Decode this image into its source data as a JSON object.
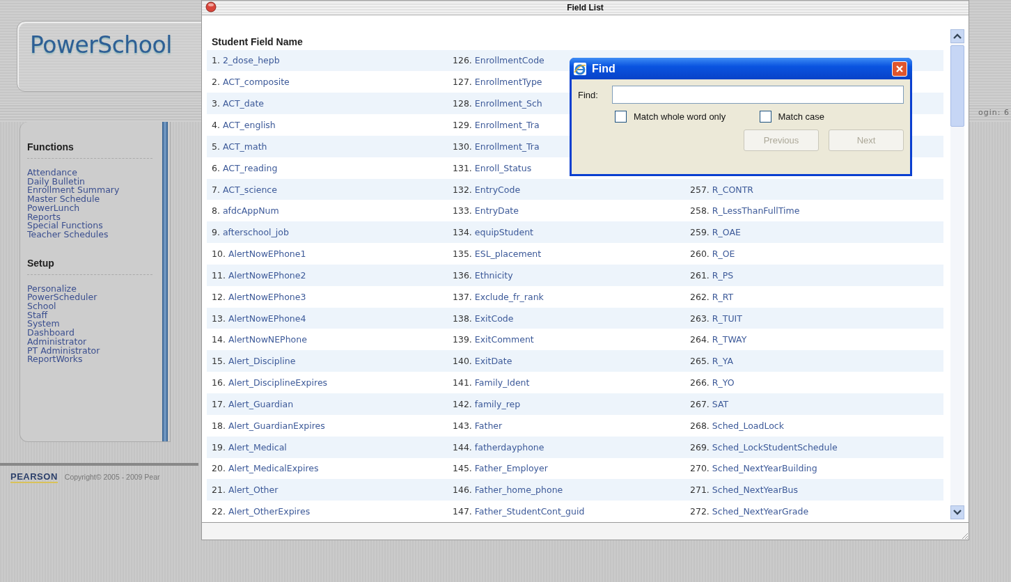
{
  "header": {
    "logo": "PowerSchool",
    "login": "ogin: 6"
  },
  "sidebar": {
    "sections": [
      {
        "title": "Functions",
        "items": [
          "Attendance",
          "Daily Bulletin",
          "Enrollment Summary",
          "Master Schedule",
          "PowerLunch",
          "Reports",
          "Special Functions",
          "Teacher Schedules"
        ]
      },
      {
        "title": "Setup",
        "items": [
          "Personalize",
          "PowerScheduler",
          "School",
          "Staff",
          "System",
          "Dashboard",
          "Administrator",
          "PT Administrator",
          "ReportWorks"
        ]
      }
    ]
  },
  "footer": {
    "brand": "PEARSON",
    "copyright": "Copyright© 2005 - 2009 Pear"
  },
  "field_list": {
    "title": "Field List",
    "heading": "Student Field Name",
    "rows": [
      {
        "column_1": {
          "number": "1.",
          "name": "2_dose_hepb"
        },
        "column_2": {
          "number": "126.",
          "name": "EnrollmentCode"
        }
      },
      {
        "column_1": {
          "number": "2.",
          "name": "ACT_composite"
        },
        "column_2": {
          "number": "127.",
          "name": "EnrollmentType"
        }
      },
      {
        "column_1": {
          "number": "3.",
          "name": "ACT_date"
        },
        "column_2": {
          "number": "128.",
          "name": "Enrollment_Sch"
        }
      },
      {
        "column_1": {
          "number": "4.",
          "name": "ACT_english"
        },
        "column_2": {
          "number": "129.",
          "name": "Enrollment_Tra"
        }
      },
      {
        "column_1": {
          "number": "5.",
          "name": "ACT_math"
        },
        "column_2": {
          "number": "130.",
          "name": "Enrollment_Tra"
        }
      },
      {
        "column_1": {
          "number": "6.",
          "name": "ACT_reading"
        },
        "column_2": {
          "number": "131.",
          "name": "Enroll_Status"
        }
      },
      {
        "column_1": {
          "number": "7.",
          "name": "ACT_science"
        },
        "column_2": {
          "number": "132.",
          "name": "EntryCode"
        },
        "column_3": {
          "number": "257.",
          "name": "R_CONTR"
        }
      },
      {
        "column_1": {
          "number": "8.",
          "name": "afdcAppNum"
        },
        "column_2": {
          "number": "133.",
          "name": "EntryDate"
        },
        "column_3": {
          "number": "258.",
          "name": "R_LessThanFullTime"
        }
      },
      {
        "column_1": {
          "number": "9.",
          "name": "afterschool_job"
        },
        "column_2": {
          "number": "134.",
          "name": "equipStudent"
        },
        "column_3": {
          "number": "259.",
          "name": "R_OAE"
        }
      },
      {
        "column_1": {
          "number": "10.",
          "name": "AlertNowEPhone1"
        },
        "column_2": {
          "number": "135.",
          "name": "ESL_placement"
        },
        "column_3": {
          "number": "260.",
          "name": "R_OE"
        }
      },
      {
        "column_1": {
          "number": "11.",
          "name": "AlertNowEPhone2"
        },
        "column_2": {
          "number": "136.",
          "name": "Ethnicity"
        },
        "column_3": {
          "number": "261.",
          "name": "R_PS"
        }
      },
      {
        "column_1": {
          "number": "12.",
          "name": "AlertNowEPhone3"
        },
        "column_2": {
          "number": "137.",
          "name": "Exclude_fr_rank"
        },
        "column_3": {
          "number": "262.",
          "name": "R_RT"
        }
      },
      {
        "column_1": {
          "number": "13.",
          "name": "AlertNowEPhone4"
        },
        "column_2": {
          "number": "138.",
          "name": "ExitCode"
        },
        "column_3": {
          "number": "263.",
          "name": "R_TUIT"
        }
      },
      {
        "column_1": {
          "number": "14.",
          "name": "AlertNowNEPhone"
        },
        "column_2": {
          "number": "139.",
          "name": "ExitComment"
        },
        "column_3": {
          "number": "264.",
          "name": "R_TWAY"
        }
      },
      {
        "column_1": {
          "number": "15.",
          "name": "Alert_Discipline"
        },
        "column_2": {
          "number": "140.",
          "name": "ExitDate"
        },
        "column_3": {
          "number": "265.",
          "name": "R_YA"
        }
      },
      {
        "column_1": {
          "number": "16.",
          "name": "Alert_DisciplineExpires"
        },
        "column_2": {
          "number": "141.",
          "name": "Family_Ident"
        },
        "column_3": {
          "number": "266.",
          "name": "R_YO"
        }
      },
      {
        "column_1": {
          "number": "17.",
          "name": "Alert_Guardian"
        },
        "column_2": {
          "number": "142.",
          "name": "family_rep"
        },
        "column_3": {
          "number": "267.",
          "name": "SAT"
        }
      },
      {
        "column_1": {
          "number": "18.",
          "name": "Alert_GuardianExpires"
        },
        "column_2": {
          "number": "143.",
          "name": "Father"
        },
        "column_3": {
          "number": "268.",
          "name": "Sched_LoadLock"
        }
      },
      {
        "column_1": {
          "number": "19.",
          "name": "Alert_Medical"
        },
        "column_2": {
          "number": "144.",
          "name": "fatherdayphone"
        },
        "column_3": {
          "number": "269.",
          "name": "Sched_LockStudentSchedule"
        }
      },
      {
        "column_1": {
          "number": "20.",
          "name": "Alert_MedicalExpires"
        },
        "column_2": {
          "number": "145.",
          "name": "Father_Employer"
        },
        "column_3": {
          "number": "270.",
          "name": "Sched_NextYearBuilding"
        }
      },
      {
        "column_1": {
          "number": "21.",
          "name": "Alert_Other"
        },
        "column_2": {
          "number": "146.",
          "name": "Father_home_phone"
        },
        "column_3": {
          "number": "271.",
          "name": "Sched_NextYearBus"
        }
      },
      {
        "column_1": {
          "number": "22.",
          "name": "Alert_OtherExpires"
        },
        "column_2": {
          "number": "147.",
          "name": "Father_StudentCont_guid"
        },
        "column_3": {
          "number": "272.",
          "name": "Sched_NextYearGrade"
        }
      }
    ]
  },
  "find_dialog": {
    "title": "Find",
    "label": "Find:",
    "options": [
      {
        "label": "Match whole word only",
        "checked": false
      },
      {
        "label": "Match case",
        "checked": false
      }
    ],
    "buttons": [
      {
        "label": "Previous",
        "disabled": true
      },
      {
        "label": "Next",
        "disabled": true
      }
    ]
  }
}
